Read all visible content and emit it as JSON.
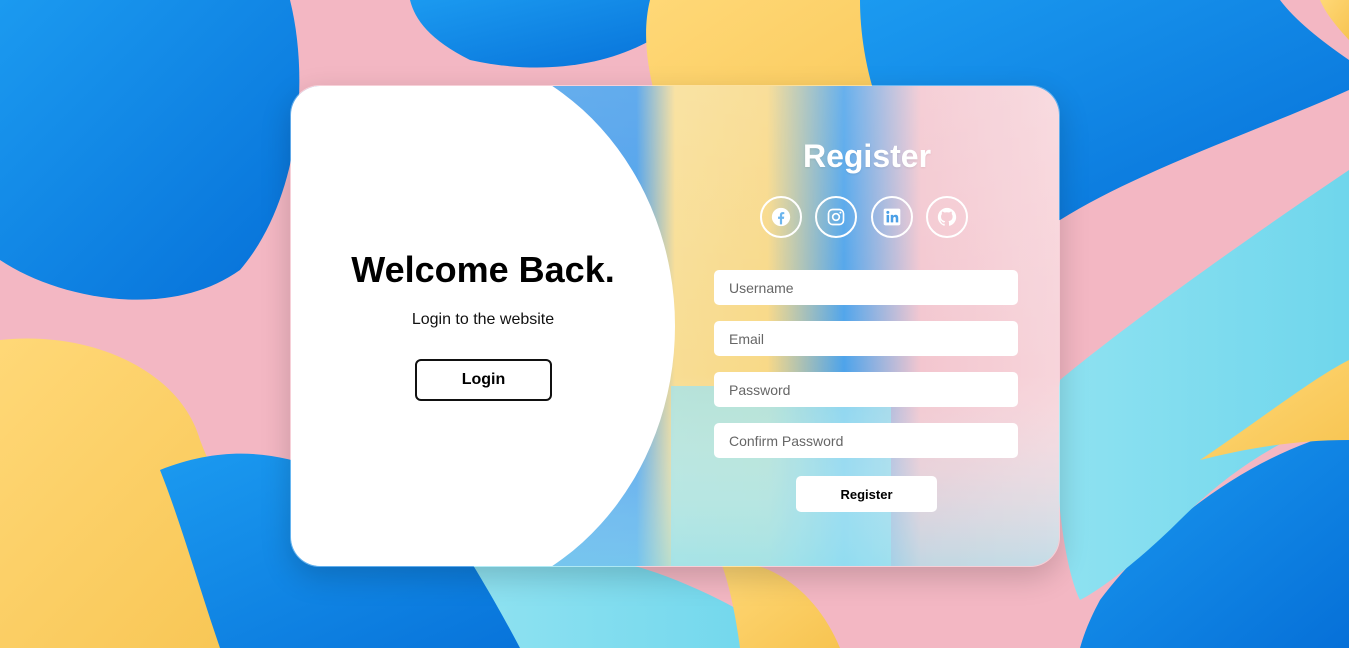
{
  "login_panel": {
    "title": "Welcome Back.",
    "subtitle": "Login to the website",
    "login_button_label": "Login"
  },
  "register_panel": {
    "title": "Register",
    "social_icons": [
      "facebook-icon",
      "instagram-icon",
      "linkedin-icon",
      "github-icon"
    ],
    "fields": {
      "username": {
        "placeholder": "Username",
        "value": ""
      },
      "email": {
        "placeholder": "Email",
        "value": ""
      },
      "password": {
        "placeholder": "Password",
        "value": ""
      },
      "confirm_password": {
        "placeholder": "Confirm Password",
        "value": ""
      }
    },
    "register_button_label": "Register"
  },
  "colors": {
    "blue": "#0a84e8",
    "pink": "#f3b7c3",
    "yellow": "#fdd36b",
    "cyan": "#7fdcee",
    "white": "#ffffff"
  }
}
